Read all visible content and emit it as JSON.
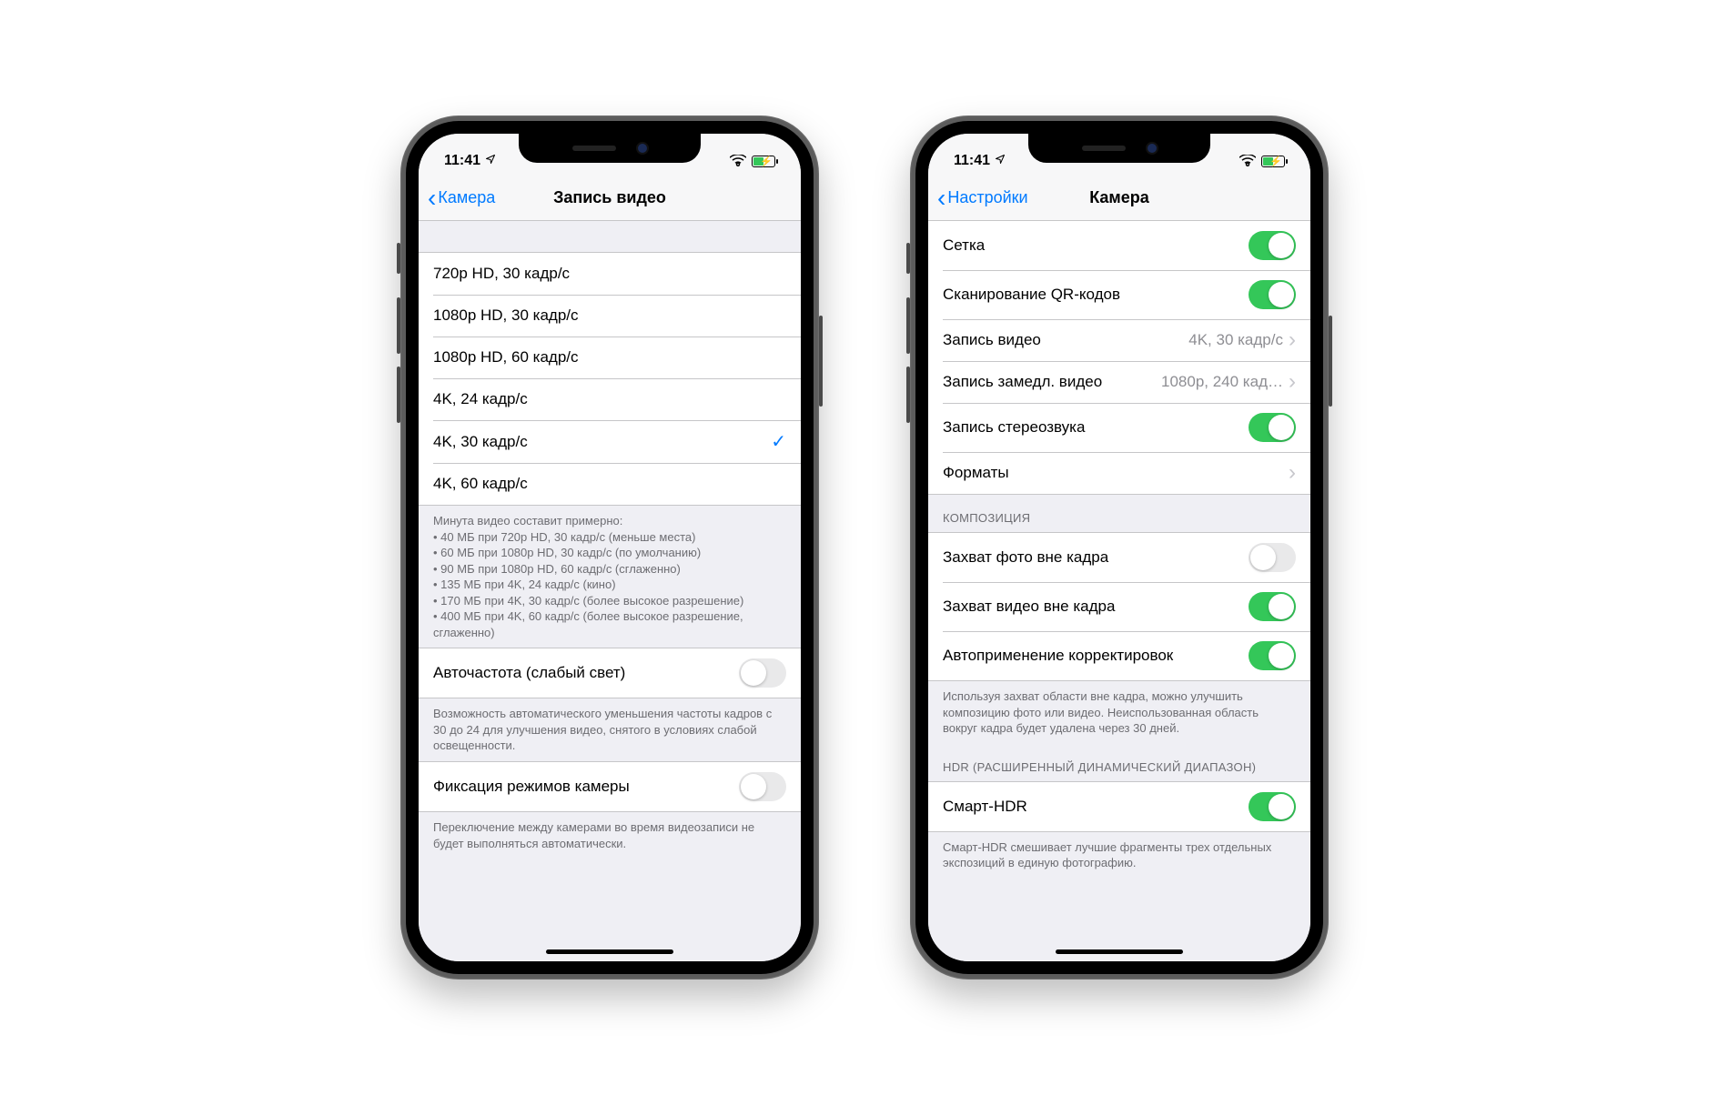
{
  "status": {
    "time": "11:41"
  },
  "phone1": {
    "nav": {
      "back": "Камера",
      "title": "Запись видео"
    },
    "options": [
      "720p HD, 30 кадр/с",
      "1080p HD, 30 кадр/с",
      "1080p HD, 60 кадр/с",
      "4K, 24 кадр/с",
      "4K, 30 кадр/с",
      "4K, 60 кадр/с"
    ],
    "selected_index": 4,
    "size_note": {
      "intro": "Минута видео составит примерно:",
      "lines": [
        "• 40 МБ при 720p HD, 30 кадр/с (меньше места)",
        "• 60 МБ при 1080p HD, 30 кадр/с (по умолчанию)",
        "• 90 МБ при 1080p HD, 60 кадр/с (сглаженно)",
        "• 135 МБ при 4K, 24 кадр/с (кино)",
        "• 170 МБ при 4K, 30 кадр/с (более высокое разрешение)",
        "• 400 МБ при 4K, 60 кадр/с (более высокое разрешение, сглаженно)"
      ]
    },
    "auto_fps": {
      "label": "Авточастота (слабый свет)",
      "on": false,
      "footer": "Возможность автоматического уменьшения частоты кадров с 30 до 24 для улучшения видео, снятого в условиях слабой освещенности."
    },
    "lock_camera": {
      "label": "Фиксация режимов камеры",
      "on": false,
      "footer": "Переключение между камерами во время видеозаписи не будет выполняться автоматически."
    }
  },
  "phone2": {
    "nav": {
      "back": "Настройки",
      "title": "Камера"
    },
    "rows": {
      "grid": {
        "label": "Сетка",
        "on": true
      },
      "qr": {
        "label": "Сканирование QR-кодов",
        "on": true
      },
      "video": {
        "label": "Запись видео",
        "value": "4K, 30 кадр/с"
      },
      "slomo": {
        "label": "Запись замедл. видео",
        "value": "1080p, 240 кад…"
      },
      "stereo": {
        "label": "Запись стереозвука",
        "on": true
      },
      "formats": {
        "label": "Форматы"
      }
    },
    "composition": {
      "header": "КОМПОЗИЦИЯ",
      "photo_outside": {
        "label": "Захват фото вне кадра",
        "on": false
      },
      "video_outside": {
        "label": "Захват видео вне кадра",
        "on": true
      },
      "auto_apply": {
        "label": "Автоприменение корректировок",
        "on": true
      },
      "footer": "Используя захват области вне кадра, можно улучшить композицию фото или видео. Неиспользованная область вокруг кадра будет удалена через 30 дней."
    },
    "hdr": {
      "header": "HDR (РАСШИРЕННЫЙ ДИНАМИЧЕСКИЙ ДИАПАЗОН)",
      "smart_hdr": {
        "label": "Смарт-HDR",
        "on": true
      },
      "footer": "Смарт-HDR смешивает лучшие фрагменты трех отдельных экспозиций в единую фотографию."
    }
  }
}
